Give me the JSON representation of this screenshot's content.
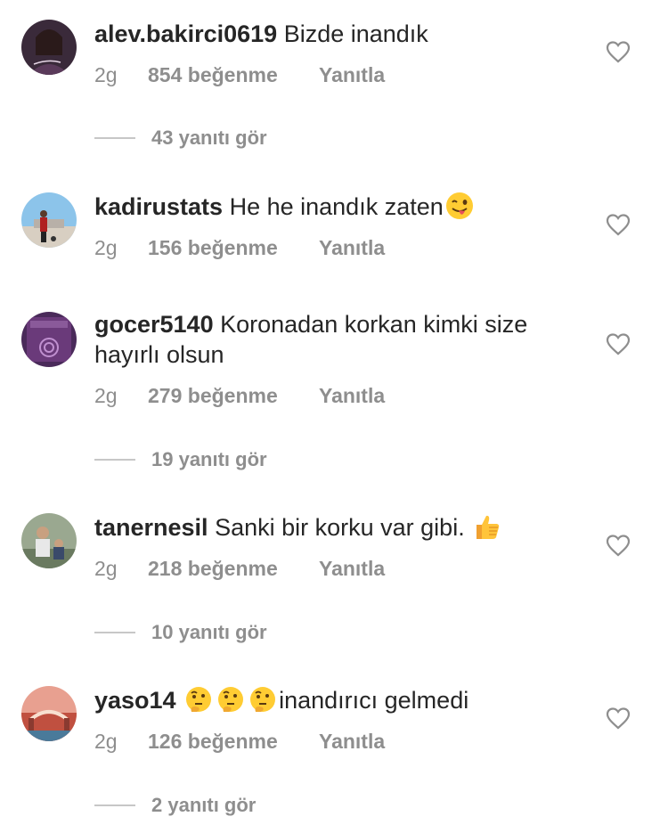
{
  "comments": [
    {
      "username": "alev.bakirci0619",
      "text": "Bizde inandık",
      "age": "2g",
      "likes": "854 beğenme",
      "reply_label": "Yanıtla",
      "replies": "43 yanıtı gör"
    },
    {
      "username": "kadirustats",
      "text": "He he inandık zaten",
      "age": "2g",
      "likes": "156 beğenme",
      "reply_label": "Yanıtla",
      "emoji": "winking-face-with-tongue"
    },
    {
      "username": "gocer5140",
      "text": "Koronadan korkan kimki size hayırlı olsun",
      "age": "2g",
      "likes": "279 beğenme",
      "reply_label": "Yanıtla",
      "replies": "19 yanıtı gör"
    },
    {
      "username": "tanernesil",
      "text": "Sanki bir korku var gibi.",
      "age": "2g",
      "likes": "218 beğenme",
      "reply_label": "Yanıtla",
      "replies": "10 yanıtı gör",
      "emoji": "thumbs-up"
    },
    {
      "username": "yaso14",
      "text": "inandırıcı gelmedi",
      "age": "2g",
      "likes": "126 beğenme",
      "reply_label": "Yanıtla",
      "replies": "2 yanıtı gör",
      "emoji": "thinking-face x3"
    }
  ],
  "colors": {
    "text": "#262626",
    "meta": "#8e8e8e",
    "divider": "#c7c7c7"
  }
}
